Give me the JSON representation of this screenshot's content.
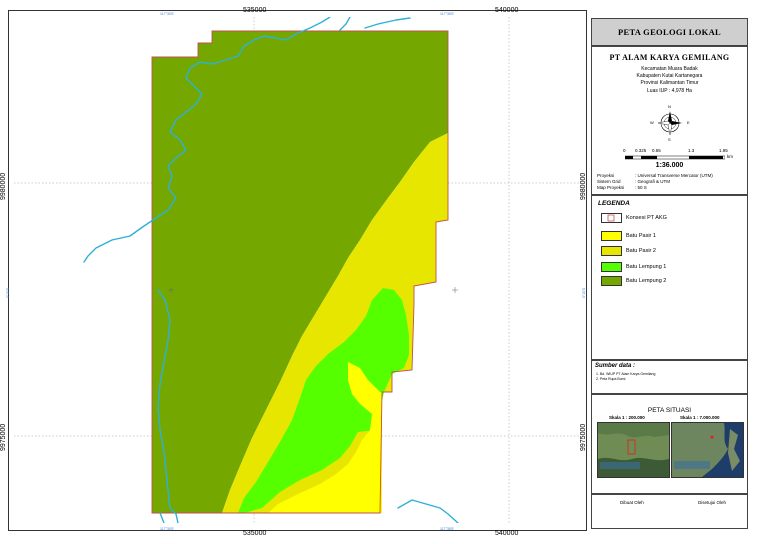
{
  "map": {
    "grid_easting": [
      "535000",
      "540000"
    ],
    "grid_northing": [
      "9980000",
      "9975000"
    ],
    "small_labels": {
      "top_left": "117°30'E",
      "top_right": "117°35'E",
      "left_mid": "0°10'S",
      "right_mid": "0°10'S",
      "bottom_left": "117°30'E",
      "bottom_right": "117°35'E"
    },
    "colors": {
      "batu_lempung_2": "#74a800",
      "batu_lempung_1": "#55ff00",
      "batu_pasir_1": "#ffff00",
      "batu_pasir_2": "#e6e600",
      "river": "#2fb0d8",
      "boundary": "#c0504d"
    }
  },
  "title": "PETA GEOLOGI LOKAL",
  "info": {
    "company": "PT ALAM KARYA GEMILANG",
    "lines": [
      "Kecamatan Muara Badak",
      "Kabupaten Kutai Kartanegara",
      "Provinsi Kalimantan Timur"
    ],
    "area": "Luas IUP : 4,978 Ha",
    "compass_labels": [
      "N",
      "W",
      "E",
      "S"
    ],
    "scale_ticks": [
      "0",
      "0.325",
      "0.65",
      "1.3",
      "1.95"
    ],
    "scale_unit": "km",
    "scale_ratio": "1:36.000",
    "projection": [
      {
        "key": "Proyeksi",
        "value": ": Universal Transverse Mercator (UTM)"
      },
      {
        "key": "Sistem Grid",
        "value": ": Geografi & UTM"
      },
      {
        "key": "Map Proyeksi",
        "value": ": 50 S"
      }
    ]
  },
  "legend": {
    "title": "LEGENDA",
    "items": [
      {
        "label": "Konsesi PT AKG",
        "color": "#ffffff",
        "kind": "outline"
      },
      {
        "label": "Batu Pasir 1",
        "color": "#ffff00",
        "kind": "fill"
      },
      {
        "label": "Batu Pasir 2",
        "color": "#e6e600",
        "kind": "fill"
      },
      {
        "label": "Batu Lempung 1",
        "color": "#55ff00",
        "kind": "fill"
      },
      {
        "label": "Batu Lempung 2",
        "color": "#74a800",
        "kind": "fill"
      }
    ]
  },
  "source": {
    "title": "Sumber data :",
    "lines": [
      "1. Bd. WIUP PT Alam Karya Gemilang",
      "2. Peta Rupa Bumi"
    ]
  },
  "situasi": {
    "title": "PETA SITUASI",
    "inset_left_label": "Skala 1 : 200.000",
    "inset_right_label": "Skala 1 : 7.000.000"
  },
  "signatures": {
    "left": "Dibuat Oleh",
    "right": "Disetujui Oleh"
  }
}
